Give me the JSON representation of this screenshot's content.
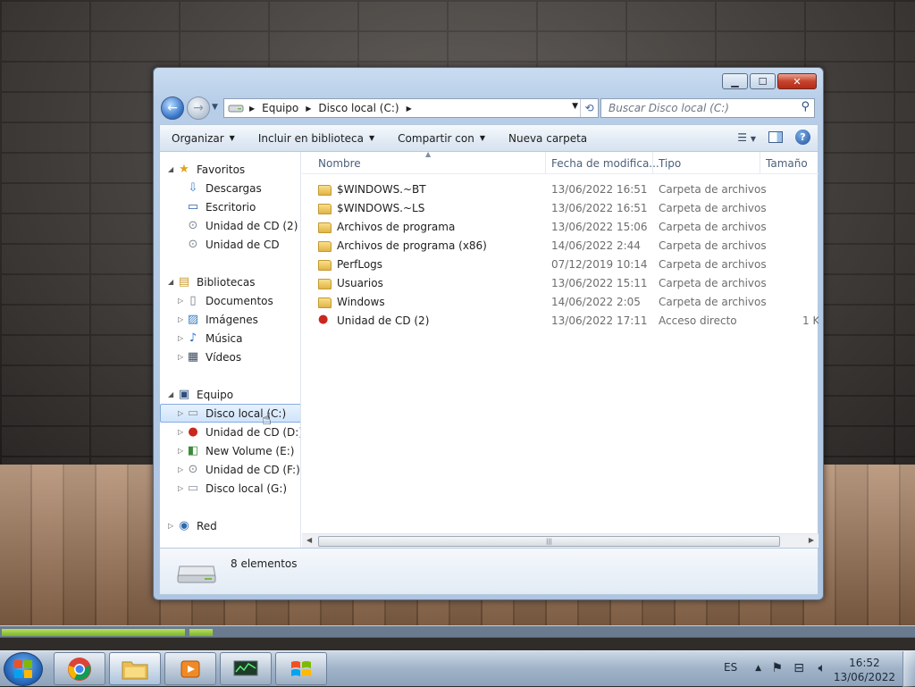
{
  "window": {
    "caption": {
      "minimize": "▁",
      "maximize": "☐",
      "close": "✕"
    }
  },
  "address": {
    "crumbs": [
      "Equipo",
      "Disco local (C:)"
    ]
  },
  "search": {
    "placeholder": "Buscar Disco local (C:)"
  },
  "toolbar": {
    "organize": "Organizar",
    "include": "Incluir en biblioteca",
    "share": "Compartir con",
    "new_folder": "Nueva carpeta"
  },
  "nav_tree": {
    "favorites": {
      "label": "Favoritos",
      "items": [
        "Descargas",
        "Escritorio",
        "Unidad de CD (2)",
        "Unidad de CD"
      ]
    },
    "libraries": {
      "label": "Bibliotecas",
      "items": [
        "Documentos",
        "Imágenes",
        "Música",
        "Vídeos"
      ]
    },
    "computer": {
      "label": "Equipo",
      "items": [
        "Disco local (C:)",
        "Unidad de CD (D:) A",
        "New Volume (E:)",
        "Unidad de CD (F:)",
        "Disco local (G:)"
      ]
    },
    "network": {
      "label": "Red"
    }
  },
  "columns": {
    "name": "Nombre",
    "date": "Fecha de modifica...",
    "type": "Tipo",
    "size": "Tamaño"
  },
  "files": [
    {
      "name": "$WINDOWS.~BT",
      "date": "13/06/2022 16:51",
      "type": "Carpeta de archivos",
      "size": ""
    },
    {
      "name": "$WINDOWS.~LS",
      "date": "13/06/2022 16:51",
      "type": "Carpeta de archivos",
      "size": ""
    },
    {
      "name": "Archivos de programa",
      "date": "13/06/2022 15:06",
      "type": "Carpeta de archivos",
      "size": ""
    },
    {
      "name": "Archivos de programa (x86)",
      "date": "14/06/2022 2:44",
      "type": "Carpeta de archivos",
      "size": ""
    },
    {
      "name": "PerfLogs",
      "date": "07/12/2019 10:14",
      "type": "Carpeta de archivos",
      "size": ""
    },
    {
      "name": "Usuarios",
      "date": "13/06/2022 15:11",
      "type": "Carpeta de archivos",
      "size": ""
    },
    {
      "name": "Windows",
      "date": "14/06/2022 2:05",
      "type": "Carpeta de archivos",
      "size": ""
    },
    {
      "name": "Unidad de CD (2)",
      "date": "13/06/2022 17:11",
      "type": "Acceso directo",
      "size": "1 K"
    }
  ],
  "details": {
    "count": "8 elementos"
  },
  "taskbar": {
    "lang": "ES",
    "time": "16:52",
    "date": "13/06/2022"
  },
  "colors": {
    "accent": "#2e6fc4",
    "selection": "#cfe4fb"
  },
  "icons": {
    "back": "arrow-left-icon",
    "forward": "arrow-right-icon",
    "search": "magnifier-icon",
    "folder": "folder-icon",
    "drive": "hard-drive-icon",
    "shortcut": "shortcut-icon"
  }
}
